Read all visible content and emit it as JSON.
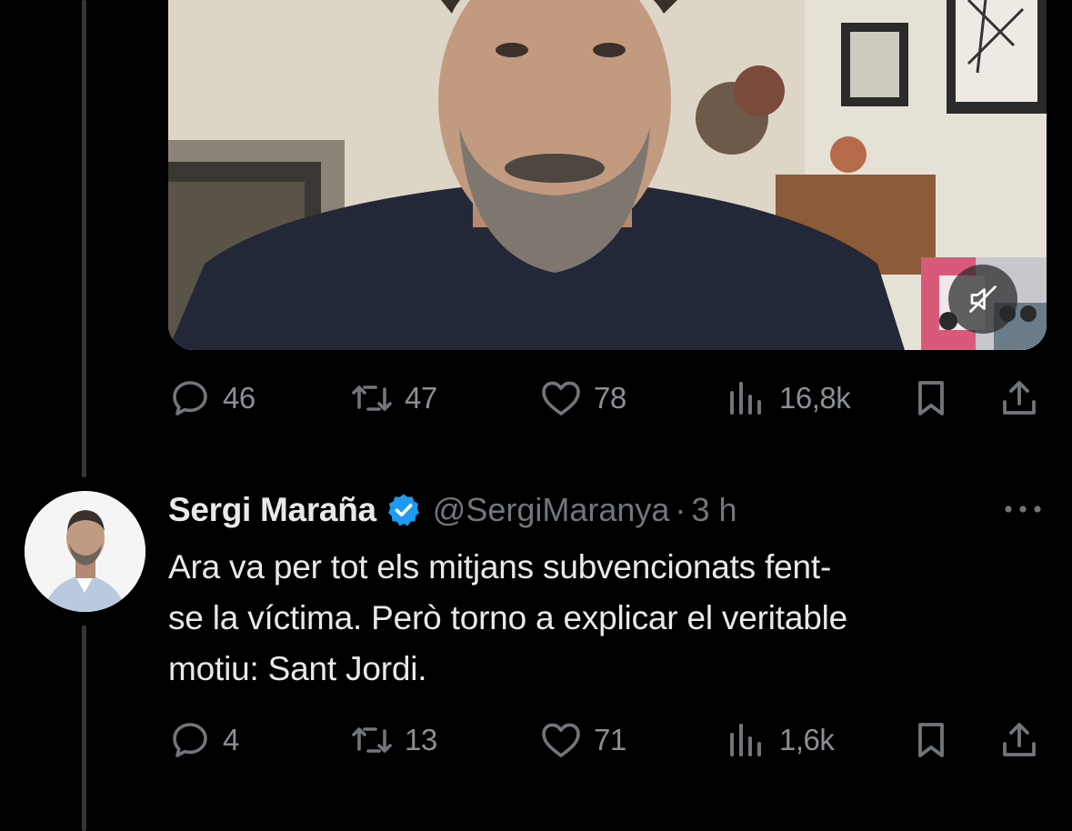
{
  "first_tweet": {
    "media": {
      "type": "video",
      "muted": true
    },
    "actions": {
      "replies": "46",
      "retweets": "47",
      "likes": "78",
      "views": "16,8k"
    }
  },
  "reply_tweet": {
    "display_name": "Sergi Maraña",
    "handle": "@SergiMaranya",
    "separator": "·",
    "time": "3 h",
    "verified": true,
    "text": "Ara va per tot els mitjans subvencionats fent-\nse la víctima. Però torno a explicar el veritable\nmotiu: Sant Jordi.",
    "actions": {
      "replies": "4",
      "retweets": "13",
      "likes": "71",
      "views": "1,6k"
    }
  },
  "icons": {
    "reply": "speech-bubble-icon",
    "retweet": "retweet-icon",
    "like": "heart-icon",
    "views": "bar-chart-icon",
    "bookmark": "bookmark-icon",
    "share": "share-icon",
    "verified": "verified-badge-icon",
    "more": "more-icon",
    "mute": "muted-speaker-icon"
  },
  "colors": {
    "background": "#000000",
    "text": "#e7e9ea",
    "muted_text": "#71767b",
    "verified": "#1d9bf0",
    "thread_line": "#333639"
  }
}
